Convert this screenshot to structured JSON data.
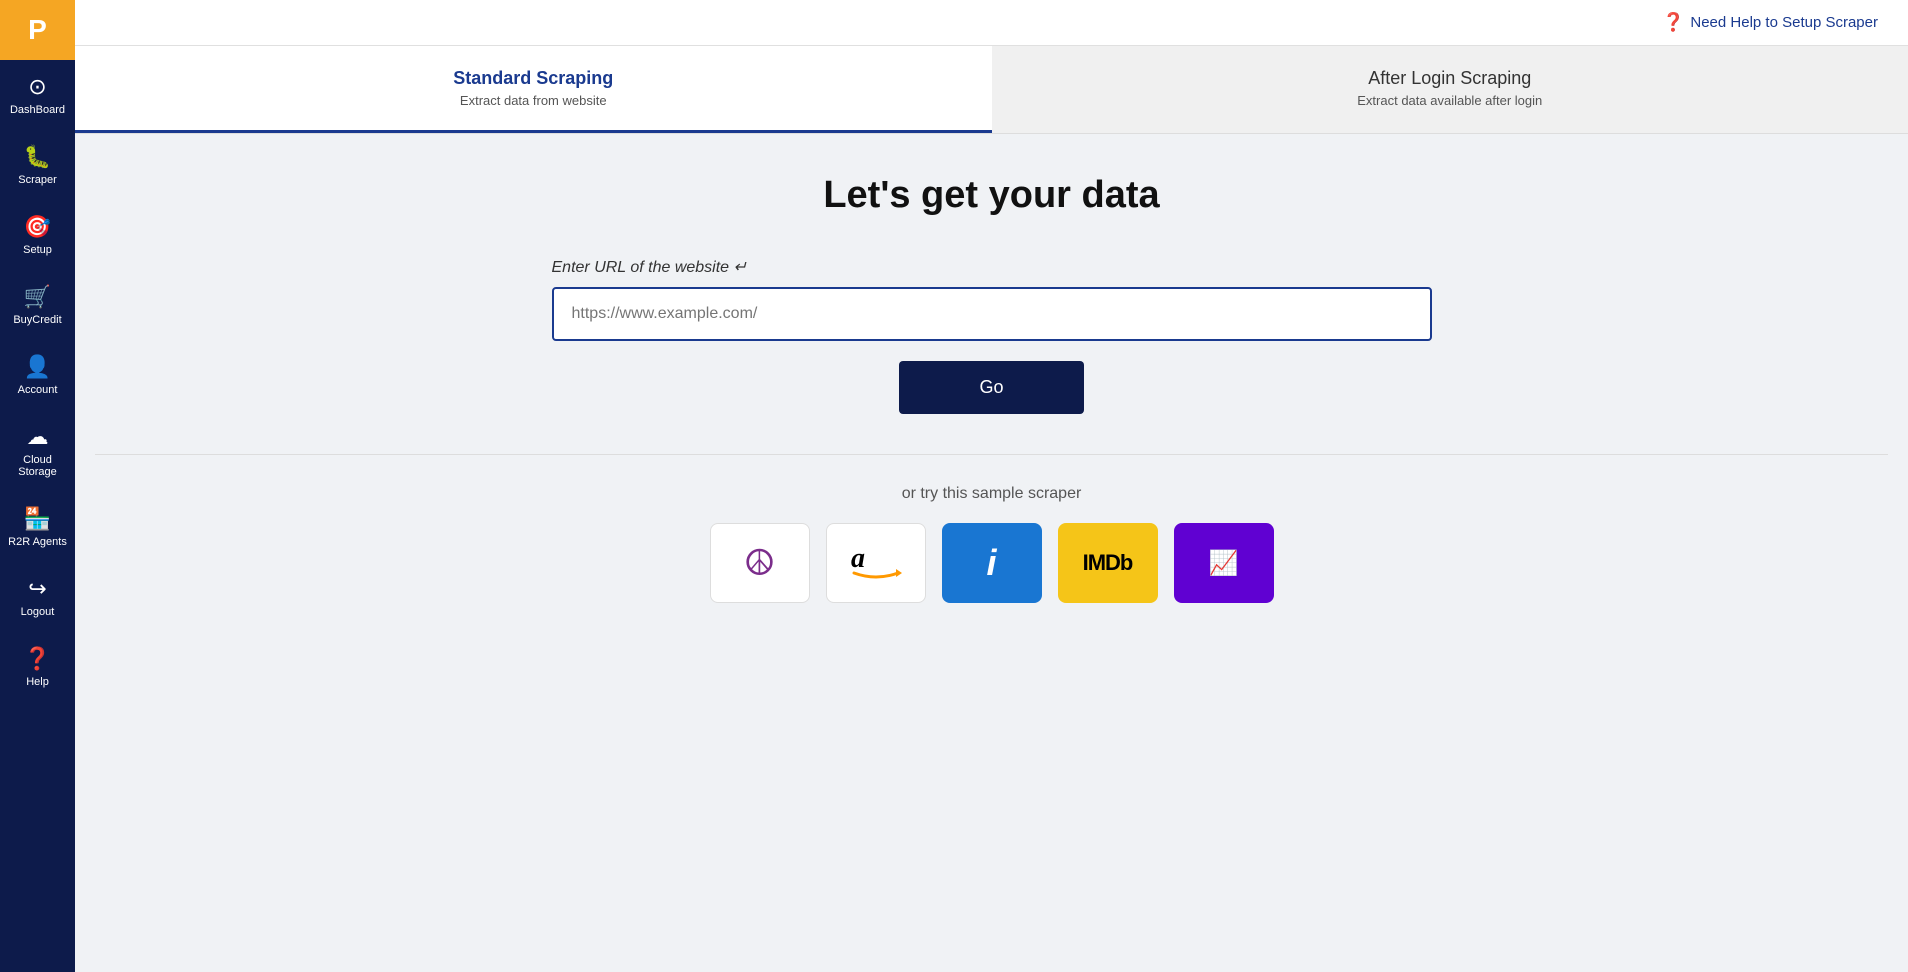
{
  "logo": {
    "letter": "P"
  },
  "sidebar": {
    "items": [
      {
        "id": "dashboard",
        "icon": "⊙",
        "label": "DashBoard"
      },
      {
        "id": "scraper",
        "icon": "🐛",
        "label": "Scraper"
      },
      {
        "id": "setup",
        "icon": "🎯",
        "label": "Setup"
      },
      {
        "id": "buycredit",
        "icon": "🛒",
        "label": "BuyCredit"
      },
      {
        "id": "account",
        "icon": "👤",
        "label": "Account"
      },
      {
        "id": "cloudstorage",
        "icon": "☁",
        "label": "Cloud Storage"
      },
      {
        "id": "r2ragents",
        "icon": "🏪",
        "label": "R2R Agents"
      },
      {
        "id": "logout",
        "icon": "↪",
        "label": "Logout"
      },
      {
        "id": "help",
        "icon": "❓",
        "label": "Help"
      }
    ]
  },
  "header": {
    "help_text": "Need Help to Setup Scraper"
  },
  "tabs": [
    {
      "id": "standard",
      "title": "Standard Scraping",
      "subtitle": "Extract data from website",
      "active": true
    },
    {
      "id": "afterlogin",
      "title": "After Login Scraping",
      "subtitle": "Extract data available after login",
      "active": false
    }
  ],
  "main": {
    "heading": "Let's get your data",
    "url_label": "Enter URL of the website ↵",
    "url_placeholder": "https://www.example.com/",
    "go_button": "Go",
    "sample_label": "or try this sample scraper",
    "sample_icons": [
      {
        "id": "peace",
        "type": "peace",
        "label": "Peace"
      },
      {
        "id": "amazon",
        "type": "amazon",
        "label": "Amazon"
      },
      {
        "id": "info",
        "type": "info",
        "label": "Info"
      },
      {
        "id": "imdb",
        "type": "imdb",
        "label": "IMDb"
      },
      {
        "id": "yahoo",
        "type": "yahoo",
        "label": "Yahoo Finance"
      }
    ]
  }
}
